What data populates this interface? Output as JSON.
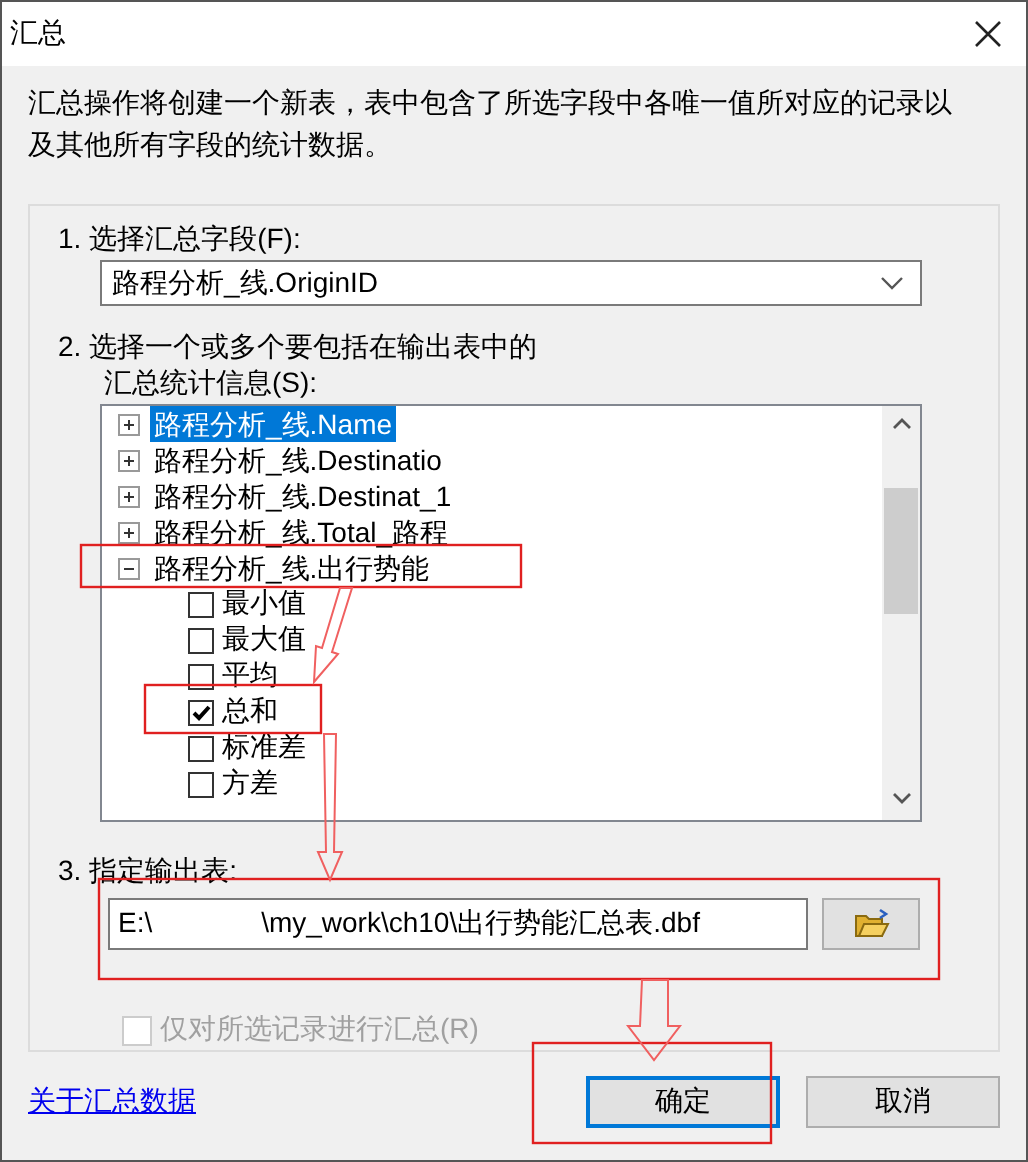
{
  "window": {
    "title": "汇总"
  },
  "description": "汇总操作将创建一个新表，表中包含了所选字段中各唯一值所对应的记录以及其他所有字段的统计数据。",
  "step1": {
    "label": "1. 选择汇总字段(F):",
    "field_value": "路程分析_线.OriginID"
  },
  "step2": {
    "label_lines": [
      "2. 选择一个或多个要包括在输出表中的",
      "汇总统计信息(S):"
    ],
    "tree": [
      {
        "label": "路程分析_线.Name",
        "expanded": false,
        "selected": true
      },
      {
        "label": "路程分析_线.Destinatio",
        "expanded": false,
        "selected": false
      },
      {
        "label": "路程分析_线.Destinat_1",
        "expanded": false,
        "selected": false
      },
      {
        "label": "路程分析_线.Total_路程",
        "expanded": false,
        "selected": false
      },
      {
        "label": "路程分析_线.出行势能",
        "expanded": true,
        "selected": false,
        "children": [
          {
            "label": "最小值",
            "checked": false
          },
          {
            "label": "最大值",
            "checked": false
          },
          {
            "label": "平均",
            "checked": false
          },
          {
            "label": "总和",
            "checked": true
          },
          {
            "label": "标准差",
            "checked": false
          },
          {
            "label": "方差",
            "checked": false
          }
        ]
      }
    ]
  },
  "step3": {
    "label": "3. 指定输出表:",
    "output_path": "E:\\              \\my_work\\ch10\\出行势能汇总表.dbf"
  },
  "selected_only": {
    "label": "仅对所选记录进行汇总(R)",
    "checked": false,
    "disabled": true
  },
  "help_link": "关于汇总数据",
  "buttons": [
    {
      "label": "确定",
      "default": true
    },
    {
      "label": "取消",
      "default": false
    }
  ]
}
